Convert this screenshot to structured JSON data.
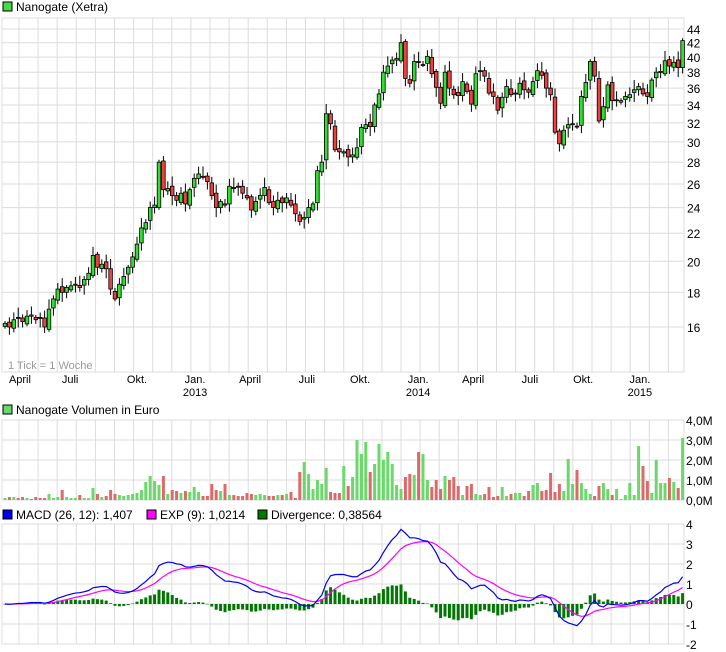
{
  "chart_data": [
    {
      "type": "candlestick",
      "title": "Nanogate (Xetra)",
      "note": "1 Tick = 1 Woche",
      "scale": "log",
      "ylim": [
        15,
        45
      ],
      "yticks": [
        16,
        18,
        20,
        22,
        24,
        26,
        28,
        30,
        32,
        34,
        36,
        38,
        40,
        42,
        44
      ],
      "xticks": [
        {
          "week": 3.4,
          "label": "April"
        },
        {
          "week": 14.8,
          "label": "Juli"
        },
        {
          "week": 30,
          "label": "Okt."
        },
        {
          "week": 43.2,
          "label": "Jan.",
          "year": "2013"
        },
        {
          "week": 55.7,
          "label": "April"
        },
        {
          "week": 68.6,
          "label": "Juli"
        },
        {
          "week": 80.7,
          "label": "Okt."
        },
        {
          "week": 93.9,
          "label": "Jan.",
          "year": "2014"
        },
        {
          "week": 106.4,
          "label": "April"
        },
        {
          "week": 119.3,
          "label": "Juli"
        },
        {
          "week": 131.4,
          "label": "Okt."
        },
        {
          "week": 144.3,
          "label": "Jan.",
          "year": "2015"
        }
      ],
      "closes": [
        16.2,
        16.0,
        16.4,
        16.5,
        16.3,
        16.6,
        16.6,
        16.4,
        16.5,
        16.0,
        17.0,
        17.6,
        18.2,
        18.0,
        18.3,
        18.4,
        18.5,
        18.3,
        18.8,
        19.2,
        20.4,
        19.6,
        19.8,
        19.5,
        18.2,
        17.6,
        18.5,
        19.0,
        19.6,
        20.3,
        21.2,
        22.4,
        22.8,
        24.0,
        24.2,
        28.0,
        25.5,
        25.6,
        25.0,
        24.6,
        25.2,
        24.3,
        25.5,
        26.5,
        26.9,
        26.6,
        26.2,
        25.0,
        24.0,
        24.5,
        24.2,
        25.8,
        25.6,
        25.8,
        25.2,
        24.8,
        23.8,
        24.5,
        25.0,
        25.7,
        24.4,
        24.0,
        24.6,
        24.4,
        24.8,
        24.2,
        23.5,
        22.9,
        23.2,
        24.0,
        24.3,
        27.2,
        28.0,
        33.0,
        31.9,
        29.2,
        29.0,
        29.0,
        28.5,
        28.7,
        29.4,
        31.5,
        31.8,
        31.6,
        34.0,
        35.3,
        38.0,
        38.8,
        39.6,
        39.8,
        42.0,
        37.2,
        36.6,
        39.4,
        39.3,
        39.0,
        40.1,
        37.8,
        36.1,
        34.2,
        38.0,
        36.0,
        35.2,
        35.1,
        36.8,
        35.6,
        34.1,
        37.8,
        38.2,
        37.5,
        35.4,
        35.0,
        33.4,
        34.9,
        36.2,
        35.2,
        35.4,
        36.6,
        35.8,
        35.5,
        36.8,
        38.2,
        37.6,
        36.0,
        35.2,
        31.0,
        29.8,
        31.2,
        31.8,
        31.9,
        31.6,
        35.0,
        36.7,
        39.4,
        37.5,
        32.2,
        33.8,
        36.4,
        34.5,
        34.6,
        34.5,
        35.0,
        35.2,
        35.8,
        36.2,
        35.3,
        35.0,
        37.0,
        38.0,
        38.1,
        39.5,
        38.8,
        39.3,
        38.6,
        42.3
      ]
    },
    {
      "type": "bar",
      "title": "Nanogate Volumen in Euro",
      "unit": "M",
      "ylim": [
        0,
        4
      ],
      "yticks": [
        "0,0M",
        "1,0M",
        "2,0M",
        "3,0M",
        "4,0M"
      ],
      "values": [
        0.1,
        0.15,
        0.15,
        0.1,
        0.15,
        0.1,
        0.05,
        0.15,
        0.1,
        0.1,
        0.3,
        0.1,
        0.15,
        0.5,
        0.15,
        0.1,
        0.1,
        0.25,
        0.1,
        0.1,
        0.6,
        0.3,
        0.15,
        0.2,
        0.5,
        0.3,
        0.25,
        0.2,
        0.25,
        0.3,
        0.35,
        0.5,
        0.9,
        1.2,
        0.95,
        0.75,
        1.2,
        0.3,
        0.5,
        0.45,
        0.35,
        0.45,
        0.4,
        0.65,
        0.4,
        0.2,
        0.2,
        0.8,
        0.5,
        0.45,
        0.8,
        0.25,
        0.25,
        0.2,
        0.2,
        0.35,
        0.3,
        0.25,
        0.3,
        0.25,
        0.2,
        0.2,
        0.25,
        0.25,
        0.3,
        0.4,
        0.1,
        1.4,
        1.9,
        1.3,
        0.55,
        1.0,
        0.8,
        1.6,
        0.4,
        0.35,
        0.35,
        1.7,
        0.7,
        1.15,
        3.0,
        2.3,
        2.9,
        1.4,
        1.8,
        2.8,
        2.0,
        2.4,
        1.8,
        0.75,
        0.55,
        1.15,
        1.3,
        1.25,
        2.4,
        2.3,
        1.0,
        0.65,
        1.0,
        0.55,
        1.2,
        1.0,
        1.15,
        0.7,
        0.25,
        0.7,
        0.8,
        0.3,
        0.25,
        0.3,
        0.65,
        0.15,
        0.2,
        0.65,
        0.2,
        0.3,
        0.35,
        0.35,
        0.2,
        0.45,
        0.75,
        0.85,
        0.45,
        0.5,
        1.35,
        0.4,
        0.8,
        0.45,
        2.05,
        0.8,
        1.5,
        0.85,
        0.55,
        0.3,
        0.2,
        0.7,
        0.85,
        0.55,
        0.25,
        0.55,
        0.05,
        0.25,
        0.85,
        0.25,
        2.7,
        1.7,
        0.95,
        0.35,
        2.0,
        0.85,
        0.85,
        1.1,
        0.9,
        0.6,
        3.1
      ]
    },
    {
      "type": "line",
      "title": "MACD",
      "ylim": [
        -2,
        4
      ],
      "yticks": [
        "-2",
        "-1",
        "0",
        "1",
        "2",
        "3",
        "4"
      ],
      "legend": [
        {
          "label": "MACD (26, 12): 1,407",
          "color": "#0000ee"
        },
        {
          "label": "EXP (9): 1,0214",
          "color": "#ff00ff"
        },
        {
          "label": "Divergence: 0,38564",
          "color": "#007700"
        }
      ]
    }
  ],
  "colors": {
    "up": "#33dd33",
    "down": "#ee4040",
    "vol_up": "#6ad86a",
    "vol_down": "#dd6a6a",
    "macd": "#0000ee",
    "signal": "#ff00ff",
    "hist": "#007700",
    "legend_price": "#44dd44"
  }
}
